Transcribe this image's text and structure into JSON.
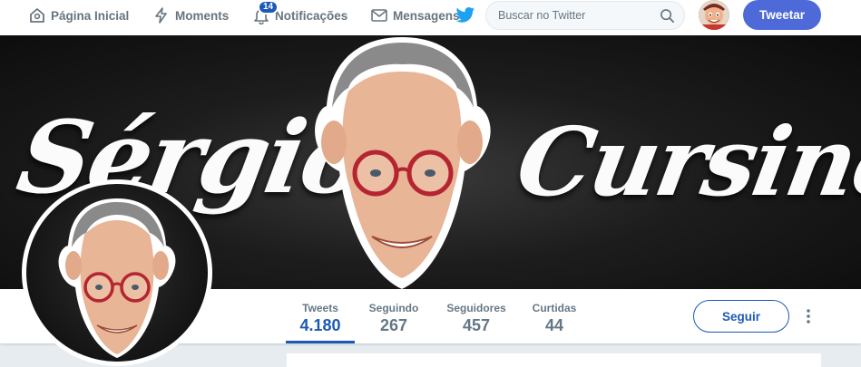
{
  "nav": {
    "home_label": "Página Inicial",
    "moments_label": "Moments",
    "notifications_label": "Notificações",
    "notifications_badge": "14",
    "messages_label": "Mensagens"
  },
  "search": {
    "placeholder": "Buscar no Twitter"
  },
  "tweet_button": "Tweetar",
  "banner": {
    "text_left": "Sérgio",
    "text_right": "Cursino"
  },
  "stats": [
    {
      "label": "Tweets",
      "value": "4.180",
      "active": true
    },
    {
      "label": "Seguindo",
      "value": "267",
      "active": false
    },
    {
      "label": "Seguidores",
      "value": "457",
      "active": false
    },
    {
      "label": "Curtidas",
      "value": "44",
      "active": false
    }
  ],
  "follow_button": "Seguir",
  "colors": {
    "accent": "#1b5ab5",
    "tweet_button": "#4e6ad8",
    "nav_text": "#66757f"
  }
}
